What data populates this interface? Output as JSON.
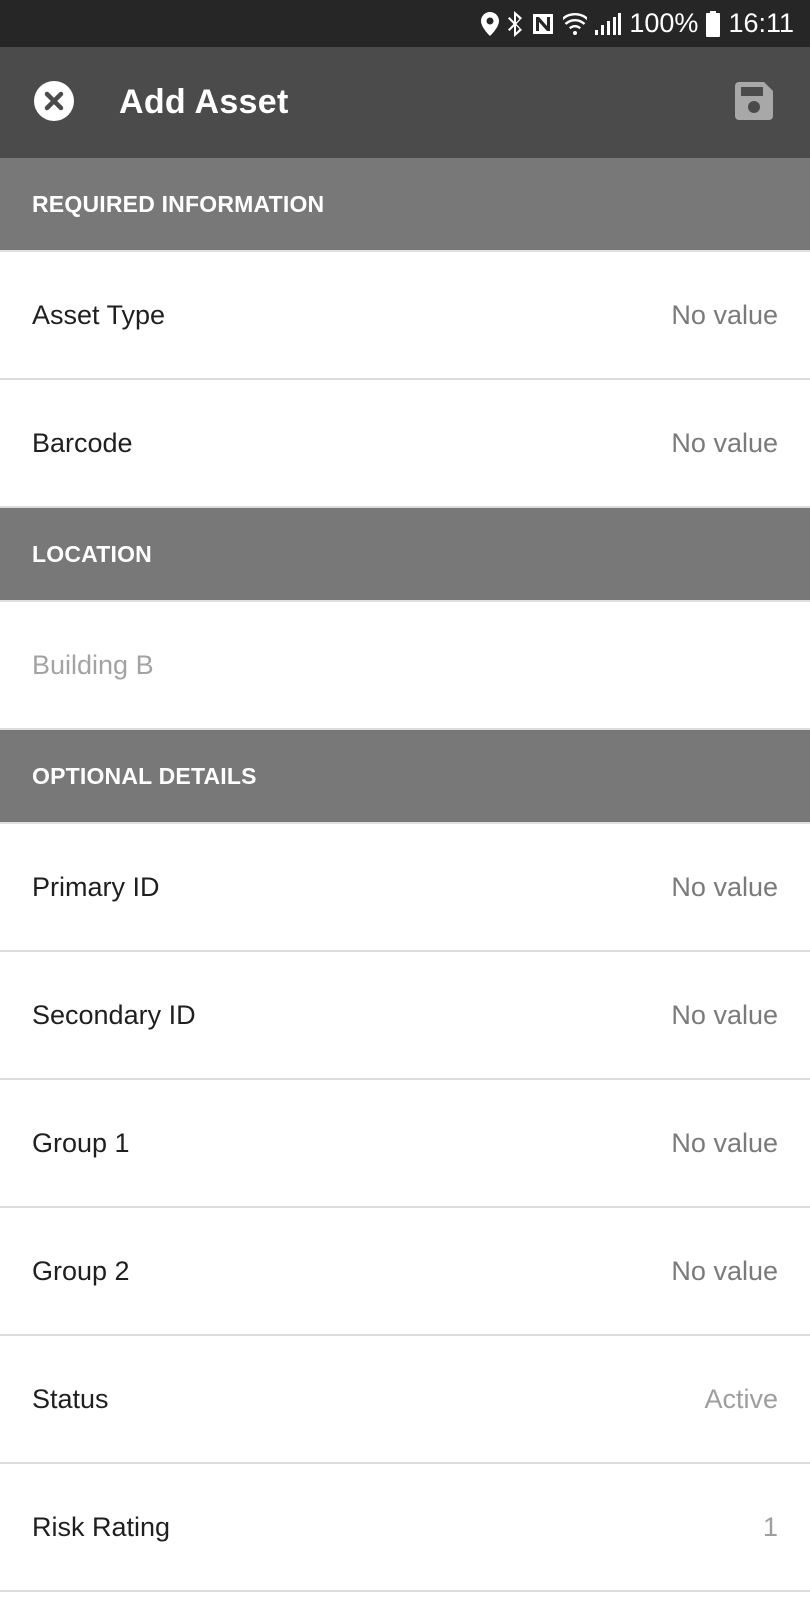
{
  "status_bar": {
    "battery": "100%",
    "time": "16:11",
    "icons": [
      "location-icon",
      "bluetooth-icon",
      "nfc-icon",
      "wifi-icon",
      "signal-icon",
      "battery-icon"
    ]
  },
  "app_bar": {
    "title": "Add Asset",
    "close_icon": "close-circle-icon",
    "save_icon": "save-icon"
  },
  "sections": {
    "required": {
      "title": "REQUIRED INFORMATION",
      "rows": [
        {
          "label": "Asset Type",
          "value": "No value"
        },
        {
          "label": "Barcode",
          "value": "No value"
        }
      ]
    },
    "location": {
      "title": "LOCATION",
      "value": "Building B"
    },
    "optional": {
      "title": "OPTIONAL DETAILS",
      "rows": [
        {
          "label": "Primary ID",
          "value": "No value"
        },
        {
          "label": "Secondary ID",
          "value": "No value"
        },
        {
          "label": "Group 1",
          "value": "No value"
        },
        {
          "label": "Group 2",
          "value": "No value"
        },
        {
          "label": "Status",
          "value": "Active"
        },
        {
          "label": "Risk Rating",
          "value": "1"
        }
      ]
    }
  },
  "colors": {
    "status_bar": "#262626",
    "app_bar": "#4b4b4b",
    "section_header": "#787878"
  }
}
